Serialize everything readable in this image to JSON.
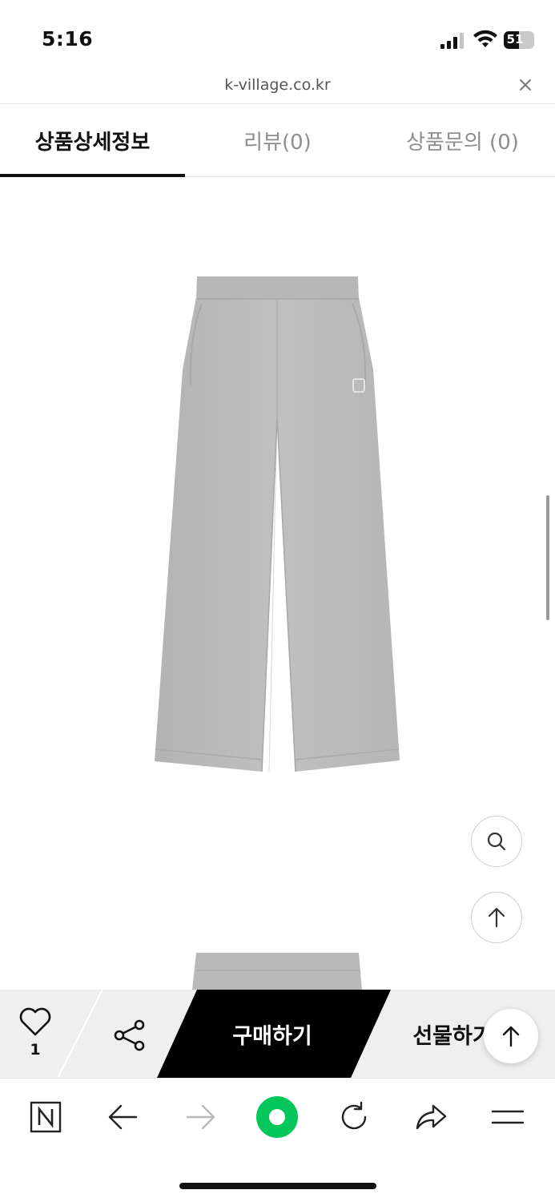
{
  "status_bar": {
    "time": "5:16",
    "battery_level": "51",
    "battery_fraction": 0.51
  },
  "url_bar": {
    "url": "k-village.co.kr"
  },
  "tabs": [
    {
      "label": "상품상세정보",
      "active": true
    },
    {
      "label": "리뷰(0)",
      "active": false
    },
    {
      "label": "상품문의 (0)",
      "active": false
    }
  ],
  "purchase_bar": {
    "like_count": "1",
    "buy_label": "구매하기",
    "gift_label": "선물하기"
  },
  "icons": {
    "toolbar": [
      "naver-n-icon",
      "back-arrow-icon",
      "forward-arrow-icon",
      "naver-green-dot-icon",
      "reload-icon",
      "share-arrow-icon",
      "menu-icon"
    ]
  },
  "colors": {
    "accent": "#03c75a",
    "buy_bg": "#000000",
    "bar_bg": "#efefef",
    "product_gray": "#b9b9b9"
  }
}
